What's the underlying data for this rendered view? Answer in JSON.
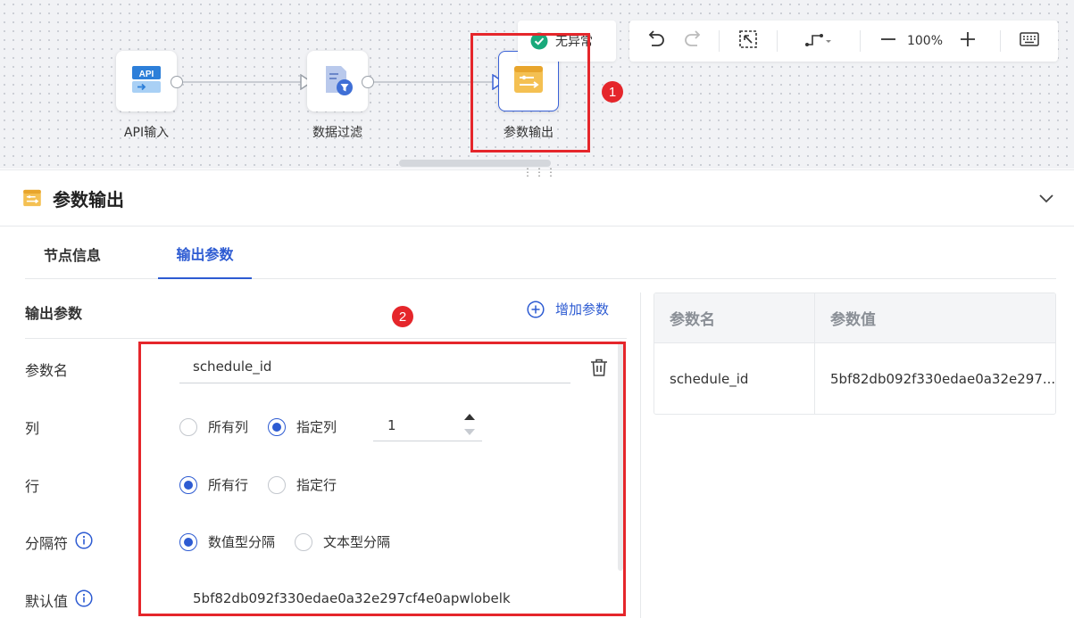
{
  "canvas": {
    "nodes": [
      {
        "label": "API输入",
        "icon": "api-input-icon"
      },
      {
        "label": "数据过滤",
        "icon": "data-filter-icon"
      },
      {
        "label": "参数输出",
        "icon": "param-output-icon"
      }
    ],
    "status": {
      "label": "无异常",
      "icon": "check-circle-icon",
      "color": "#19a97b"
    },
    "toolbar": {
      "zoom": "100%"
    },
    "annotations": [
      "1",
      "2"
    ]
  },
  "panel": {
    "title": "参数输出",
    "tabs": [
      "节点信息",
      "输出参数"
    ],
    "active_tab": "输出参数",
    "section_title": "输出参数",
    "add_param_label": "增加参数",
    "form": {
      "param_name_label": "参数名",
      "param_name_value": "schedule_id",
      "column_label": "列",
      "column_options": [
        "所有列",
        "指定列"
      ],
      "column_selected": "指定列",
      "column_value": "1",
      "row_label": "行",
      "row_options": [
        "所有行",
        "指定行"
      ],
      "row_selected": "所有行",
      "separator_label": "分隔符",
      "separator_options": [
        "数值型分隔",
        "文本型分隔"
      ],
      "separator_selected": "数值型分隔",
      "default_label": "默认值",
      "default_value": "5bf82db092f330edae0a32e297cf4e0apwlobelk"
    },
    "table": {
      "headers": [
        "参数名",
        "参数值"
      ],
      "rows": [
        [
          "schedule_id",
          "5bf82db092f330edae0a32e297..."
        ]
      ]
    }
  },
  "colors": {
    "accent": "#2d5bd2",
    "annotation": "#e5262b",
    "node_icon": "#f0b43c"
  }
}
